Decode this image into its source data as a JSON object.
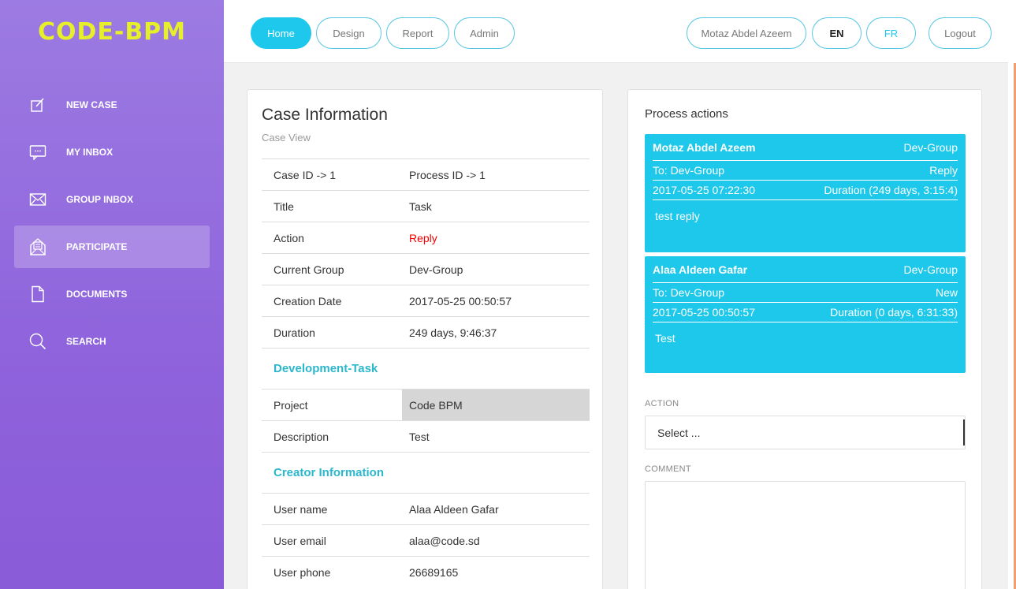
{
  "brand": {
    "logo_text": "CODE-BPM",
    "logo_color": "#e6ef2a"
  },
  "colors": {
    "accent": "#1dc8ec",
    "sidebar_top": "#9c7be2",
    "sidebar_bottom": "#8a5bd8",
    "action_red": "#ee0000",
    "section_teal": "#2bb7cc"
  },
  "sidebar": {
    "items": [
      {
        "label": "NEW CASE",
        "icon": "edit-icon"
      },
      {
        "label": "MY INBOX",
        "icon": "chat-icon"
      },
      {
        "label": "GROUP INBOX",
        "icon": "envelope-icon"
      },
      {
        "label": "PARTICIPATE",
        "icon": "open-envelope-icon",
        "active": true
      },
      {
        "label": "DOCUMENTS",
        "icon": "document-icon"
      },
      {
        "label": "SEARCH",
        "icon": "search-icon"
      }
    ]
  },
  "topnav": {
    "tabs": [
      {
        "label": "Home",
        "active": true
      },
      {
        "label": "Design"
      },
      {
        "label": "Report"
      },
      {
        "label": "Admin"
      }
    ],
    "user": "Motaz Abdel Azeem",
    "lang_en": "EN",
    "lang_fr": "FR",
    "logout": "Logout"
  },
  "case": {
    "title": "Case Information",
    "subtitle": "Case View",
    "rows": [
      {
        "key": "Case ID -> 1",
        "value": "Process ID -> 1"
      },
      {
        "key": "Title",
        "value": "Task"
      },
      {
        "key": "Action",
        "value": "Reply"
      },
      {
        "key": "Current Group",
        "value": "Dev-Group"
      },
      {
        "key": "Creation Date",
        "value": "2017-05-25 00:50:57"
      },
      {
        "key": "Duration",
        "value": "249 days, 9:46:37"
      }
    ],
    "section_task": "Development-Task",
    "task_rows": [
      {
        "key": "Project",
        "value": "Code BPM"
      },
      {
        "key": "Description",
        "value": "Test"
      }
    ],
    "section_creator": "Creator Information",
    "creator_rows": [
      {
        "key": "User name",
        "value": "Alaa Aldeen Gafar"
      },
      {
        "key": "User email",
        "value": "alaa@code.sd"
      },
      {
        "key": "User phone",
        "value": "26689165"
      }
    ]
  },
  "process": {
    "title": "Process actions",
    "messages": [
      {
        "from": "Motaz Abdel Azeem",
        "group": "Dev-Group",
        "to": "To: Dev-Group",
        "action": "Reply",
        "date": "2017-05-25 07:22:30",
        "duration": "Duration (249 days, 3:15:4)",
        "body": "test reply"
      },
      {
        "from": "Alaa Aldeen Gafar",
        "group": "Dev-Group",
        "to": "To: Dev-Group",
        "action": "New",
        "date": "2017-05-25 00:50:57",
        "duration": "Duration (0 days, 6:31:33)",
        "body": "Test"
      }
    ],
    "action_label": "ACTION",
    "action_value": "Select ...",
    "comment_label": "COMMENT"
  }
}
